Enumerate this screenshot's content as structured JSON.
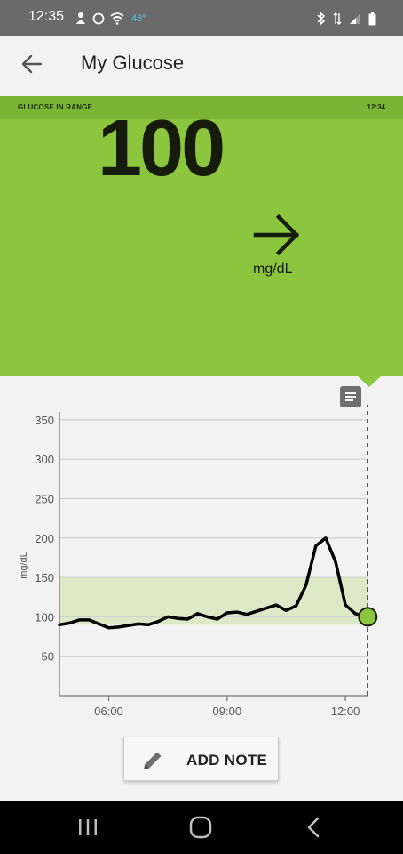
{
  "status_bar": {
    "time": "12:35",
    "temperature": "48°",
    "left_icons": [
      "notification-icon",
      "circle-icon",
      "wifi-shield-icon"
    ],
    "right_icons": [
      "bluetooth-icon",
      "data-icon",
      "signal-icon",
      "battery-icon"
    ]
  },
  "app_bar": {
    "title": "My Glucose",
    "back_icon": "arrow-back-icon"
  },
  "glucose": {
    "range_label": "GLUCOSE IN RANGE",
    "reading_time": "12:34",
    "value": "100",
    "unit": "mg/dL",
    "trend_icon": "arrow-right-icon",
    "status_color": "#8cc63f"
  },
  "chart_data": {
    "type": "line",
    "ylabel": "mg/dL",
    "ylim": [
      0,
      360
    ],
    "yticks": [
      50,
      100,
      150,
      200,
      250,
      300,
      350
    ],
    "y_tick_labels": [
      "50",
      "100",
      "150",
      "200",
      "250",
      "300",
      "350"
    ],
    "xlim": [
      "04:45",
      "12:35"
    ],
    "x_tick_labels": [
      "06:00",
      "09:00",
      "12:00"
    ],
    "x_tick_values": [
      "06:00",
      "09:00",
      "12:00"
    ],
    "target_range": [
      90,
      150
    ],
    "grid": true,
    "series": [
      {
        "x": [
          "04:45",
          "05:00",
          "05:15",
          "05:30",
          "05:45",
          "06:00",
          "06:15",
          "06:30",
          "06:45",
          "07:00",
          "07:15",
          "07:30",
          "07:45",
          "08:00",
          "08:15",
          "08:30",
          "08:45",
          "09:00",
          "09:15",
          "09:30",
          "09:45",
          "10:00",
          "10:15",
          "10:30",
          "10:45",
          "11:00",
          "11:15",
          "11:30",
          "11:45",
          "12:00",
          "12:15",
          "12:34"
        ],
        "values": [
          90,
          92,
          96,
          96,
          91,
          86,
          87,
          89,
          91,
          90,
          94,
          100,
          98,
          97,
          104,
          100,
          97,
          105,
          106,
          103,
          107,
          111,
          115,
          108,
          114,
          140,
          190,
          200,
          170,
          115,
          104,
          100
        ]
      }
    ],
    "current_reading": {
      "x": "12:34",
      "y": 100
    },
    "colors": {
      "line": "#000000",
      "target_band": "#dce9c6",
      "grid": "#cfcfcf",
      "current_marker": "#8cc63f"
    }
  },
  "chart_controls": {
    "note_list_icon": "note-list-icon"
  },
  "add_note": {
    "label": "ADD NOTE",
    "icon": "pencil-icon"
  },
  "nav_bar": {
    "icons": [
      "recent-apps-icon",
      "home-icon",
      "back-nav-icon"
    ]
  }
}
